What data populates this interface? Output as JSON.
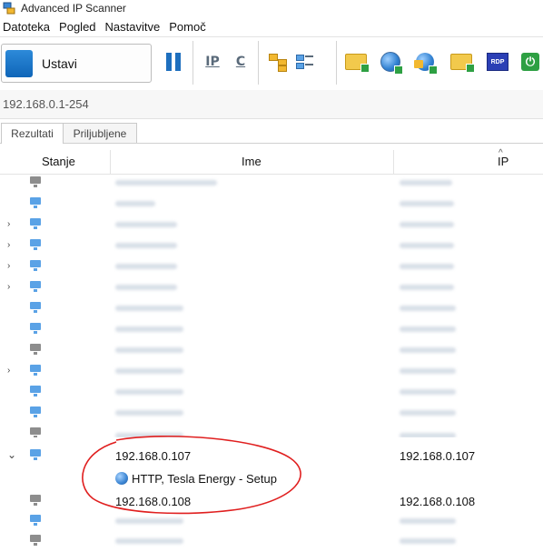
{
  "window": {
    "title": "Advanced IP Scanner"
  },
  "menu": [
    "Datoteka",
    "Pogled",
    "Nastavitve",
    "Pomoč"
  ],
  "toolbar": {
    "scan_label": "Ustavi",
    "ip_label": "IP",
    "c_label": "C",
    "rdp_label": "RDP"
  },
  "scan_range": "192.168.0.1-254",
  "tabs": [
    "Rezultati",
    "Priljubljene"
  ],
  "columns": {
    "status": "Stanje",
    "name": "Ime",
    "ip": "IP"
  },
  "rows": {
    "r107": {
      "name": "192.168.0.107",
      "ip": "192.168.0.107"
    },
    "r107_service": "HTTP, Tesla Energy - Setup",
    "r108": {
      "name": "192.168.0.108",
      "ip": "192.168.0.108"
    }
  },
  "colors": {
    "accent": "#1e6fbe",
    "device_blue": "#5aa2e6",
    "device_gray": "#808080",
    "annotation": "#e01f1f"
  },
  "icons": [
    "advanced-ip-scanner-icon",
    "pause-icon",
    "ip-icon",
    "c-icon",
    "expand-tree-icon",
    "collapse-tree-icon",
    "folder-icon",
    "globe-icon",
    "lock-globe-icon",
    "ftp-folder-icon",
    "rdp-icon",
    "power-icon",
    "computer-icon",
    "globe-service-icon"
  ]
}
